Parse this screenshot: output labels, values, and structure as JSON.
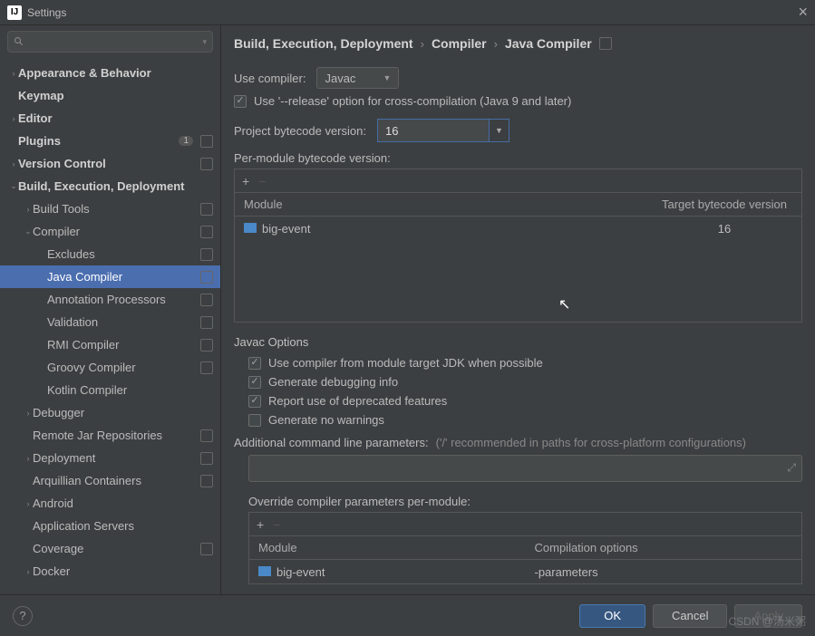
{
  "window": {
    "title": "Settings"
  },
  "search": {
    "placeholder": ""
  },
  "sidebar": {
    "items": [
      {
        "label": "Appearance & Behavior",
        "indent": 0,
        "chev": "›",
        "bold": true,
        "sep": false
      },
      {
        "label": "Keymap",
        "indent": 0,
        "chev": "",
        "bold": true,
        "sep": false
      },
      {
        "label": "Editor",
        "indent": 0,
        "chev": "›",
        "bold": true,
        "sep": false
      },
      {
        "label": "Plugins",
        "indent": 0,
        "chev": "",
        "bold": true,
        "sep": true,
        "badge": "1"
      },
      {
        "label": "Version Control",
        "indent": 0,
        "chev": "›",
        "bold": true,
        "sep": true
      },
      {
        "label": "Build, Execution, Deployment",
        "indent": 0,
        "chev": "⌄",
        "bold": true,
        "sep": false
      },
      {
        "label": "Build Tools",
        "indent": 1,
        "chev": "›",
        "bold": false,
        "sep": true
      },
      {
        "label": "Compiler",
        "indent": 1,
        "chev": "⌄",
        "bold": false,
        "sep": true
      },
      {
        "label": "Excludes",
        "indent": 2,
        "chev": "",
        "bold": false,
        "sep": true
      },
      {
        "label": "Java Compiler",
        "indent": 2,
        "chev": "",
        "bold": false,
        "sep": true,
        "selected": true
      },
      {
        "label": "Annotation Processors",
        "indent": 2,
        "chev": "",
        "bold": false,
        "sep": true
      },
      {
        "label": "Validation",
        "indent": 2,
        "chev": "",
        "bold": false,
        "sep": true
      },
      {
        "label": "RMI Compiler",
        "indent": 2,
        "chev": "",
        "bold": false,
        "sep": true
      },
      {
        "label": "Groovy Compiler",
        "indent": 2,
        "chev": "",
        "bold": false,
        "sep": true
      },
      {
        "label": "Kotlin Compiler",
        "indent": 2,
        "chev": "",
        "bold": false,
        "sep": false
      },
      {
        "label": "Debugger",
        "indent": 1,
        "chev": "›",
        "bold": false,
        "sep": false
      },
      {
        "label": "Remote Jar Repositories",
        "indent": 1,
        "chev": "",
        "bold": false,
        "sep": true
      },
      {
        "label": "Deployment",
        "indent": 1,
        "chev": "›",
        "bold": false,
        "sep": true
      },
      {
        "label": "Arquillian Containers",
        "indent": 1,
        "chev": "",
        "bold": false,
        "sep": true
      },
      {
        "label": "Android",
        "indent": 1,
        "chev": "›",
        "bold": false,
        "sep": false
      },
      {
        "label": "Application Servers",
        "indent": 1,
        "chev": "",
        "bold": false,
        "sep": false
      },
      {
        "label": "Coverage",
        "indent": 1,
        "chev": "",
        "bold": false,
        "sep": true
      },
      {
        "label": "Docker",
        "indent": 1,
        "chev": "›",
        "bold": false,
        "sep": false
      }
    ]
  },
  "breadcrumb": {
    "a": "Build, Execution, Deployment",
    "b": "Compiler",
    "c": "Java Compiler"
  },
  "main": {
    "useCompilerLabel": "Use compiler:",
    "useCompilerValue": "Javac",
    "releaseOption": "Use '--release' option for cross-compilation (Java 9 and later)",
    "projectBytecodeLabel": "Project bytecode version:",
    "projectBytecodeValue": "16",
    "perModuleLabel": "Per-module bytecode version:",
    "table1": {
      "h1": "Module",
      "h2": "Target bytecode version",
      "rows": [
        {
          "module": "big-event",
          "version": "16"
        }
      ]
    },
    "javacTitle": "Javac Options",
    "opt1": "Use compiler from module target JDK when possible",
    "opt2": "Generate debugging info",
    "opt3": "Report use of deprecated features",
    "opt4": "Generate no warnings",
    "addParamsLabel": "Additional command line parameters:",
    "addParamsHint": "('/' recommended in paths for cross-platform configurations)",
    "overrideLabel": "Override compiler parameters per-module:",
    "table2": {
      "h1": "Module",
      "h2": "Compilation options",
      "rows": [
        {
          "module": "big-event",
          "opts": "-parameters"
        }
      ]
    }
  },
  "footer": {
    "ok": "OK",
    "cancel": "Cancel",
    "apply": "Apply"
  },
  "watermark": "CSDN @汤米粥"
}
